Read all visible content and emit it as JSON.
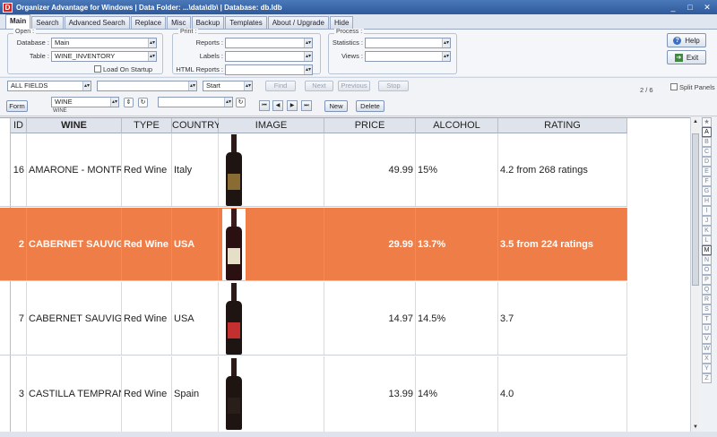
{
  "window": {
    "title": "Organizer Advantage for Windows | Data Folder: ...\\data\\db\\ | Database: db.ldb",
    "app_icon": "D",
    "controls": [
      "_",
      "□",
      "✕"
    ]
  },
  "tabs": [
    "Main",
    "Search",
    "Advanced Search",
    "Replace",
    "Misc",
    "Backup",
    "Templates",
    "About / Upgrade",
    "Hide"
  ],
  "open_group": {
    "title": "Open :",
    "database_label": "Database :",
    "database_value": "Main",
    "table_label": "Table :",
    "table_value": "WINE_INVENTORY",
    "load_on_startup": "Load On Startup"
  },
  "print_group": {
    "title": "Print :",
    "reports_label": "Reports :",
    "labels_label": "Labels :",
    "html_reports_label": "HTML Reports :"
  },
  "process_group": {
    "title": "Process :",
    "statistics_label": "Statistics :",
    "views_label": "Views :"
  },
  "side_buttons": {
    "help": "Help",
    "exit": "Exit"
  },
  "search": {
    "field": "ALL FIELDS",
    "value": "",
    "position": "Start",
    "find": "Find",
    "next": "Next",
    "previous": "Previous",
    "stop": "Stop",
    "counter": "2 / 6",
    "split_panels": "Split Panels"
  },
  "formbar": {
    "form": "Form",
    "sort_field": "WINE",
    "sort_sub": "WINE",
    "new": "New",
    "delete": "Delete",
    "nav": [
      "⏮",
      "◀",
      "▶",
      "⏭"
    ]
  },
  "grid": {
    "columns": [
      "ID",
      "WINE",
      "TYPE",
      "COUNTRY",
      "IMAGE",
      "PRICE",
      "ALCOHOL",
      "RATING"
    ],
    "row_marker": "I",
    "rows": [
      {
        "id": "16",
        "wine": "AMARONE - MONTRESOR",
        "type": "Red Wine",
        "country": "Italy",
        "price": "49.99",
        "alcohol": "15%",
        "rating": "4.2 from 268 ratings",
        "image": "wine-bottle-icon"
      },
      {
        "id": "2",
        "wine": "CABERNET SAUVIGNON",
        "type": "Red Wine",
        "country": "USA",
        "price": "29.99",
        "alcohol": "13.7%",
        "rating": "3.5 from 224 ratings",
        "image": "wine-bottle-icon",
        "selected": true
      },
      {
        "id": "7",
        "wine": "CABERNET SAUVIGNON",
        "type": "Red Wine",
        "country": "USA",
        "price": "14.97",
        "alcohol": "14.5%",
        "rating": "3.7",
        "image": "wine-bottle-icon"
      },
      {
        "id": "3",
        "wine": "CASTILLA TEMPRANILLO",
        "type": "Red Wine",
        "country": "Spain",
        "price": "13.99",
        "alcohol": "14%",
        "rating": "4.0",
        "image": "wine-bottle-icon"
      }
    ]
  },
  "letter_bar": [
    "★",
    "A",
    "B",
    "C",
    "D",
    "E",
    "F",
    "G",
    "H",
    "I",
    "J",
    "K",
    "L",
    "M",
    "N",
    "O",
    "P",
    "Q",
    "R",
    "S",
    "T",
    "U",
    "V",
    "W",
    "X",
    "Y",
    "Z"
  ],
  "colors": {
    "selected_row": "#ef7d48",
    "title_bar": "#2e5a9c"
  }
}
